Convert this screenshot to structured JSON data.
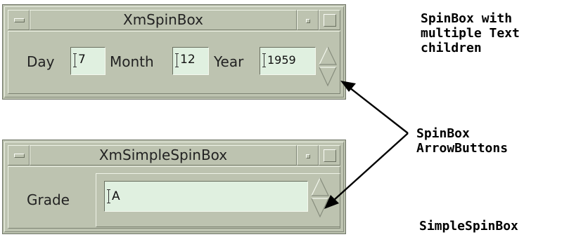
{
  "spinbox_window": {
    "title": "XmSpinBox",
    "fields": [
      {
        "label": "Day",
        "value": "7"
      },
      {
        "label": "Month",
        "value": "12"
      },
      {
        "label": "Year",
        "value": "1959"
      }
    ]
  },
  "simple_spinbox_window": {
    "title": "XmSimpleSpinBox",
    "field": {
      "label": "Grade",
      "value": "A"
    }
  },
  "annotations": {
    "spinbox_multiple": "SpinBox with\nmultiple Text\nchildren",
    "arrow_buttons": "SpinBox\nArrowButtons",
    "simple_spinbox": "SimpleSpinBox"
  },
  "colors": {
    "window_bg": "#bdc3b0",
    "field_bg": "#e0f0e0",
    "annotation_text": "#000000"
  },
  "icons": [
    "window-menu-icon",
    "minimize-icon",
    "maximize-icon",
    "spin-up-arrow-icon",
    "spin-down-arrow-icon"
  ]
}
